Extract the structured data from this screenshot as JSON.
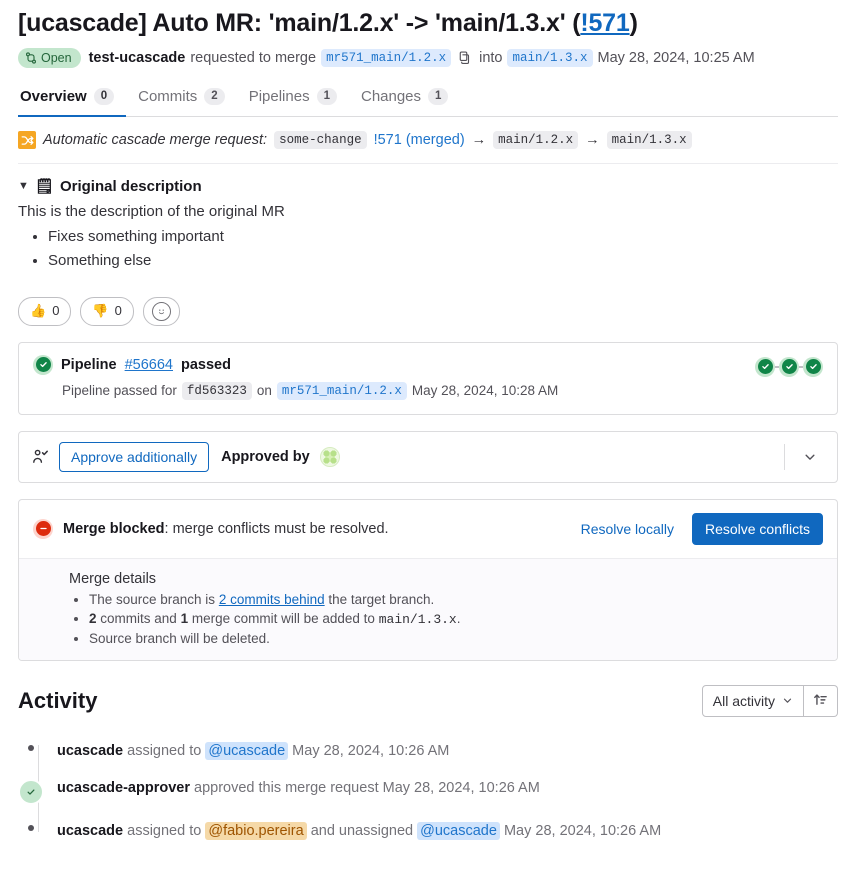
{
  "mr": {
    "title_prefix": "[ucascade] Auto MR: 'main/1.2.x' -> 'main/1.3.x' (",
    "title_iid": "!571",
    "title_suffix": ")",
    "status": "Open",
    "author": "test-ucascade",
    "requested_text": "requested to merge",
    "source_branch": "mr571_main/1.2.x",
    "into_text": "into",
    "target_branch": "main/1.3.x",
    "created_at": "May 28, 2024, 10:25 AM",
    "copy_icon": "clipboard-copy-icon",
    "status_icon": "merge-request-open-icon"
  },
  "tabs": [
    {
      "label": "Overview",
      "count": "0",
      "active": true
    },
    {
      "label": "Commits",
      "count": "2",
      "active": false
    },
    {
      "label": "Pipelines",
      "count": "1",
      "active": false
    },
    {
      "label": "Changes",
      "count": "1",
      "active": false
    }
  ],
  "cascade": {
    "icon": "shuffle-icon",
    "label": "Automatic cascade merge request:",
    "project": "some-change",
    "source_mr": "!571 (merged)",
    "arrow1": "→",
    "branch_from": "main/1.2.x",
    "arrow2": "→",
    "branch_to": "main/1.3.x"
  },
  "description": {
    "caret": "▼",
    "note_icon": "🗒",
    "header": "Original description",
    "body": "This is the description of the original MR",
    "bullets": [
      "Fixes something important",
      "Something else"
    ]
  },
  "reactions": [
    {
      "emoji": "👍",
      "name": "thumbs-up",
      "count": "0"
    },
    {
      "emoji": "👎",
      "name": "thumbs-down",
      "count": "0"
    }
  ],
  "reaction_add_icon": "add-reaction-smiley-icon",
  "pipeline": {
    "status_icon": "status-success-icon",
    "prefix": "Pipeline",
    "id": "#56664",
    "state": "passed",
    "sub_prefix": "Pipeline passed for",
    "commit_sha": "fd563323",
    "sub_on": "on",
    "branch": "mr571_main/1.2.x",
    "finished_at": "May 28, 2024, 10:28 AM",
    "stages": [
      "passed",
      "passed",
      "passed"
    ]
  },
  "approval": {
    "icon": "approval-check-icon",
    "button_label": "Approve additionally",
    "approved_by_label": "Approved by",
    "avatar": "ucascade-approver-avatar",
    "expand_icon": "chevron-down-icon"
  },
  "merge": {
    "status_icon": "merge-blocked-icon",
    "blocked_label": "Merge blocked",
    "blocked_reason": ": merge conflicts must be resolved.",
    "resolve_locally": "Resolve locally",
    "resolve_conflicts": "Resolve conflicts",
    "details_title": "Merge details",
    "detail_1_pre": "The source branch is",
    "detail_1_link": "2 commits behind",
    "detail_1_post": "the target branch.",
    "detail_2_a": "2",
    "detail_2_b": "commits and",
    "detail_2_c": "1",
    "detail_2_d": "merge commit will be added to",
    "detail_2_branch": "main/1.3.x",
    "detail_2_end": ".",
    "detail_3": "Source branch will be deleted."
  },
  "activity": {
    "title": "Activity",
    "filter_label": "All activity",
    "filter_icon": "chevron-down-icon",
    "sort_icon": "sort-ascending-icon",
    "items": [
      {
        "marker": "dot",
        "actor": "ucascade",
        "action": "assigned to",
        "mention": "@ucascade",
        "mention_current": false,
        "action2": "",
        "mention2": "",
        "date": "May 28, 2024, 10:26 AM"
      },
      {
        "marker": "approved",
        "actor": "ucascade-approver",
        "action": "approved this merge request",
        "mention": "",
        "mention_current": false,
        "action2": "",
        "mention2": "",
        "date": "May 28, 2024, 10:26 AM"
      },
      {
        "marker": "dot",
        "actor": "ucascade",
        "action": "assigned to",
        "mention": "@fabio.pereira",
        "mention_current": true,
        "action2": "and unassigned",
        "mention2": "@ucascade",
        "date": "May 28, 2024, 10:26 AM"
      }
    ]
  },
  "colors": {
    "link": "#1068bf",
    "primary": "#1068bf",
    "success": "#108548",
    "danger": "#dd2b0e",
    "cascade": "#f5a623"
  }
}
